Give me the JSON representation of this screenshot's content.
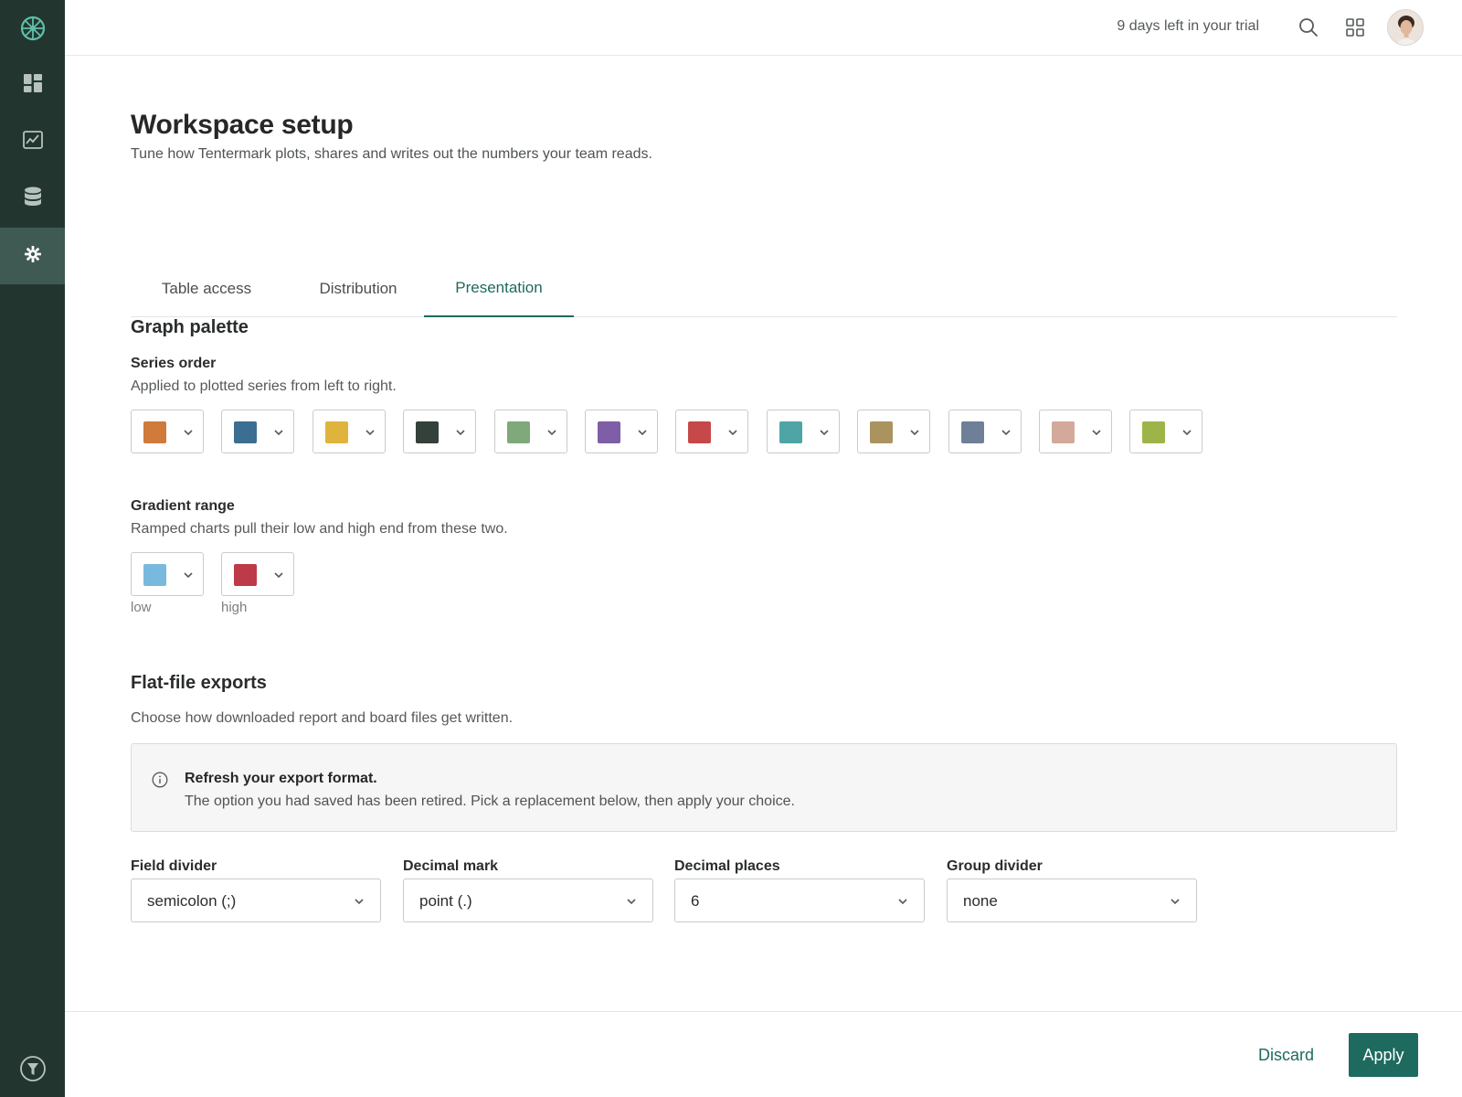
{
  "sidebar": {
    "logo_icon": "wheel-logo-icon",
    "items": [
      {
        "name": "dashboard",
        "icon": "dashboard-grid-icon",
        "active": false
      },
      {
        "name": "charts",
        "icon": "line-chart-icon",
        "active": false
      },
      {
        "name": "data",
        "icon": "database-icon",
        "active": false
      },
      {
        "name": "settings",
        "icon": "gear-icon",
        "active": true
      }
    ],
    "help_icon": "help-filter-icon"
  },
  "topbar": {
    "trial_text": "9 days left in your trial",
    "search_icon": "search-icon",
    "apps_icon": "apps-grid-icon",
    "avatar": "user-avatar"
  },
  "page": {
    "title": "Workspace setup",
    "subtitle": "Tune how Tentermark plots, shares and writes out the numbers your team reads."
  },
  "tabs": [
    {
      "label": "Table access",
      "active": false
    },
    {
      "label": "Distribution",
      "active": false
    },
    {
      "label": "Presentation",
      "active": true
    }
  ],
  "graph_palette": {
    "title": "Graph palette",
    "series_order": {
      "label": "Series order",
      "help": "Applied to plotted series from left to right.",
      "colors": [
        "#d07a3c",
        "#3c6e92",
        "#e0b43c",
        "#34403a",
        "#7fa97a",
        "#7e5ea6",
        "#c64848",
        "#4fa4a6",
        "#ab9360",
        "#6f7f97",
        "#d2a99b",
        "#9db548"
      ]
    },
    "gradient_range": {
      "label": "Gradient range",
      "help": "Ramped charts pull their low and high end from these two.",
      "low_color": "#79b9dd",
      "high_color": "#bd3a48",
      "low_label": "low",
      "high_label": "high"
    }
  },
  "exports": {
    "title": "Flat-file exports",
    "help": "Choose how downloaded report and board files get written.",
    "callout": {
      "icon": "info-icon",
      "title": "Refresh your export format.",
      "body": "The option you had saved has been retired. Pick a replacement below, then apply your choice."
    },
    "fields": [
      {
        "label": "Field divider",
        "value": "semicolon (;)"
      },
      {
        "label": "Decimal mark",
        "value": "point (.)"
      },
      {
        "label": "Decimal places",
        "value": "6"
      },
      {
        "label": "Group divider",
        "value": "none"
      }
    ]
  },
  "footer": {
    "discard_label": "Discard",
    "apply_label": "Apply"
  },
  "colors": {
    "sidebar": "#22362f",
    "sidebar_active": "#3f5a52",
    "accent": "#1e6a5e"
  }
}
